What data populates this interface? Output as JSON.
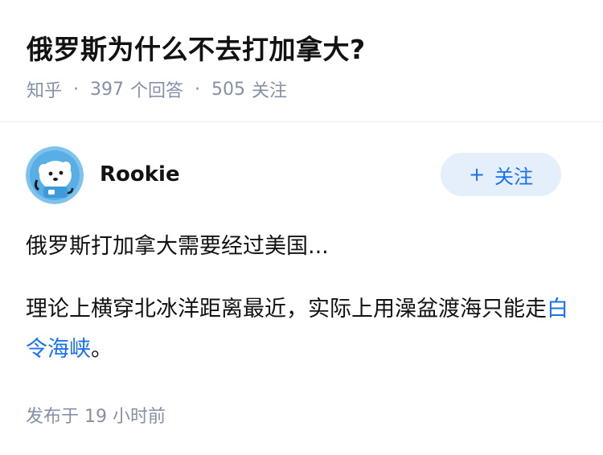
{
  "question": {
    "title": "俄罗斯为什么不去打加拿大?",
    "source": "知乎",
    "answer_count": "397",
    "answer_label": "个回答",
    "follow_count": "505",
    "follow_label": "关注"
  },
  "answer": {
    "author": {
      "name": "Rookie",
      "avatar_icon": "cartoon-avatar-icon"
    },
    "follow_button": {
      "plus": "+",
      "label": "关注"
    },
    "paragraph1": "俄罗斯打加拿大需要经过美国...",
    "paragraph2_text": "理论上横穿北冰洋距离最近，实际上用澡盆渡海只能走",
    "paragraph2_link": "白令海峡",
    "paragraph2_end": "。",
    "published": "发布于 19 小时前"
  },
  "colors": {
    "title": "#121212",
    "meta": "#8590a6",
    "accent": "#1772f6",
    "follow_bg": "#e5eefb"
  }
}
